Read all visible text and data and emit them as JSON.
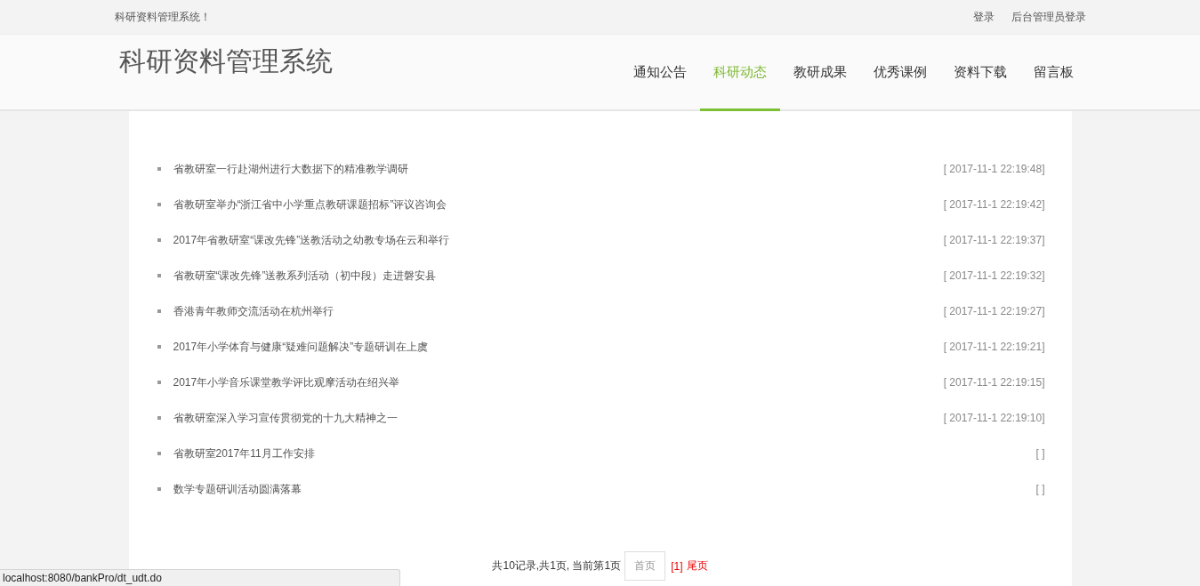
{
  "top_bar": {
    "welcome": "科研资料管理系统！",
    "links": [
      "登录",
      "后台管理员登录"
    ]
  },
  "header": {
    "logo": "科研资料管理系统",
    "nav": [
      {
        "label": "通知公告",
        "selected": false
      },
      {
        "label": "科研动态",
        "selected": true
      },
      {
        "label": "教研成果",
        "selected": false
      },
      {
        "label": "优秀课例",
        "selected": false
      },
      {
        "label": "资料下载",
        "selected": false
      },
      {
        "label": "留言板",
        "selected": false
      }
    ]
  },
  "news": [
    {
      "title": "省教研室一行赴湖州进行大数据下的精准教学调研",
      "date": "[ 2017-11-1 22:19:48]"
    },
    {
      "title": "省教研室举办“浙江省中小学重点教研课题招标”评议咨询会",
      "date": "[ 2017-11-1 22:19:42]"
    },
    {
      "title": "2017年省教研室“课改先锋”送教活动之幼教专场在云和举行",
      "date": "[ 2017-11-1 22:19:37]"
    },
    {
      "title": "省教研室“课改先锋”送教系列活动（初中段）走进磐安县",
      "date": "[ 2017-11-1 22:19:32]"
    },
    {
      "title": "香港青年教师交流活动在杭州举行",
      "date": "[ 2017-11-1 22:19:27]"
    },
    {
      "title": "2017年小学体育与健康“疑难问题解决”专题研训在上虞",
      "date": "[ 2017-11-1 22:19:21]"
    },
    {
      "title": "2017年小学音乐课堂教学评比观摩活动在绍兴举",
      "date": "[ 2017-11-1 22:19:15]"
    },
    {
      "title": "省教研室深入学习宣传贯彻党的十九大精神之一",
      "date": "[ 2017-11-1 22:19:10]"
    },
    {
      "title": "省教研室2017年11月工作安排",
      "date": "[ ]"
    },
    {
      "title": "数学专题研训活动圆满落幕",
      "date": "[ ]"
    }
  ],
  "pager": {
    "summary": "共10记录,共1页, 当前第1页",
    "first": "首页",
    "current": "[1]",
    "last": "尾页"
  },
  "status_bar": {
    "url": "localhost:8080/bankPro/dt_udt.do"
  }
}
